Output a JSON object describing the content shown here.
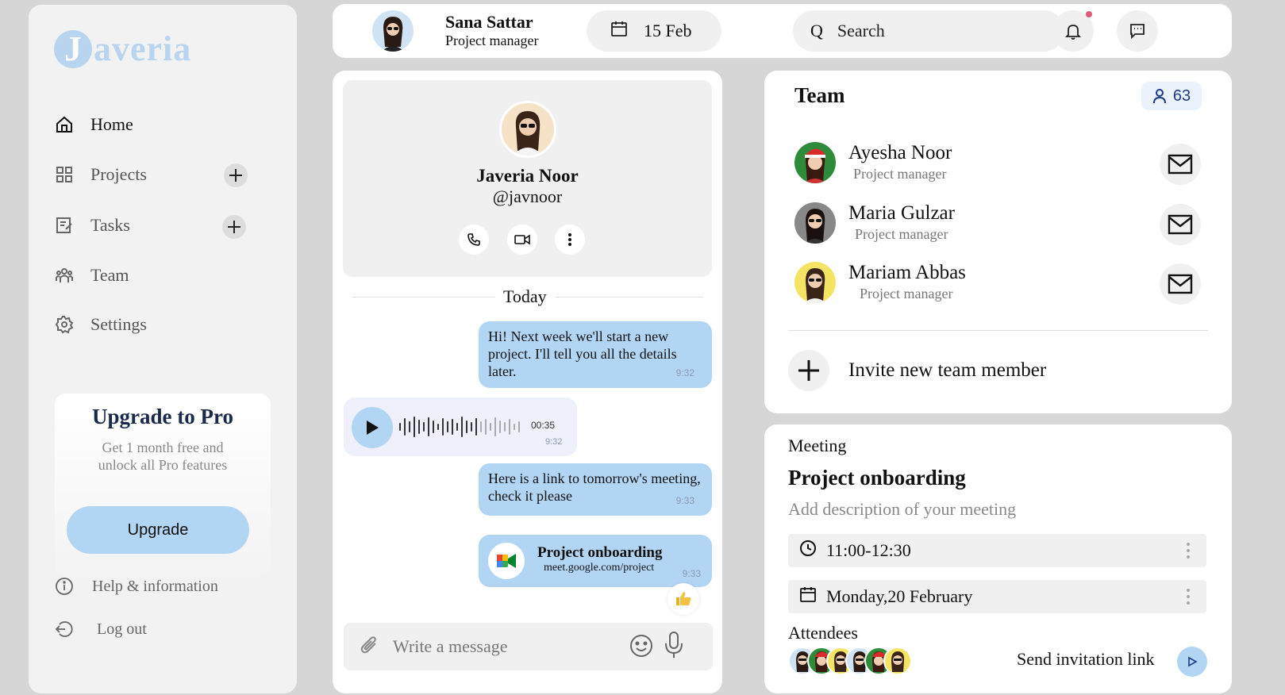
{
  "brand": {
    "logo_letter": "J",
    "logo_rest": "averia"
  },
  "sidebar": {
    "items": [
      {
        "label": "Home",
        "icon": "home-icon",
        "active": true,
        "has_add": false
      },
      {
        "label": "Projects",
        "icon": "grid-icon",
        "active": false,
        "has_add": true
      },
      {
        "label": "Tasks",
        "icon": "edit-icon",
        "active": false,
        "has_add": true
      },
      {
        "label": "Team",
        "icon": "people-icon",
        "active": false,
        "has_add": false
      },
      {
        "label": "Settings",
        "icon": "gear-icon",
        "active": false,
        "has_add": false
      }
    ],
    "upgrade": {
      "title": "Upgrade to Pro",
      "subtitle": "Get 1 month free and unlock all Pro features",
      "button": "Upgrade"
    },
    "footer": [
      {
        "label": "Help & information",
        "icon": "info-icon"
      },
      {
        "label": "Log out",
        "icon": "logout-icon"
      }
    ]
  },
  "header": {
    "user_name": "Sana Sattar",
    "user_role": "Project manager",
    "date": "15 Feb",
    "search_placeholder": "Search",
    "search_glyph": "Q"
  },
  "chat": {
    "contact_name": "Javeria Noor",
    "contact_handle": "@javnoor",
    "day_label": "Today",
    "messages": [
      {
        "text": "Hi! Next week we'll start a new project. I'll tell you all the details later.",
        "time": "9:32"
      },
      {
        "voice_duration": "00:35",
        "time": "9:32"
      },
      {
        "text": "Here is a link to tomorrow's meeting, check it please",
        "time": "9:33"
      },
      {
        "link_title": "Project onboarding",
        "link_url": "meet.google.com/project",
        "time": "9:33"
      }
    ],
    "composer_placeholder": "Write a message"
  },
  "team": {
    "title": "Team",
    "count": "63",
    "members": [
      {
        "name": "Ayesha Noor",
        "role": "Project manager",
        "avatar_bg": "#2e8b3a"
      },
      {
        "name": "Maria Gulzar",
        "role": "Project manager",
        "avatar_bg": "#888888"
      },
      {
        "name": "Mariam Abbas",
        "role": "Project manager",
        "avatar_bg": "#f5e463"
      }
    ],
    "invite_label": "Invite new team member"
  },
  "meeting": {
    "label": "Meeting",
    "title": "Project onboarding",
    "description": "Add description of your meeting",
    "time": "11:00-12:30",
    "date": "Monday,20 February",
    "attendees_label": "Attendees",
    "send_label": "Send invitation link"
  },
  "colors": {
    "accent": "#b3d5f4",
    "notification": "#e05a7a",
    "count_text": "#1e3a8a"
  }
}
